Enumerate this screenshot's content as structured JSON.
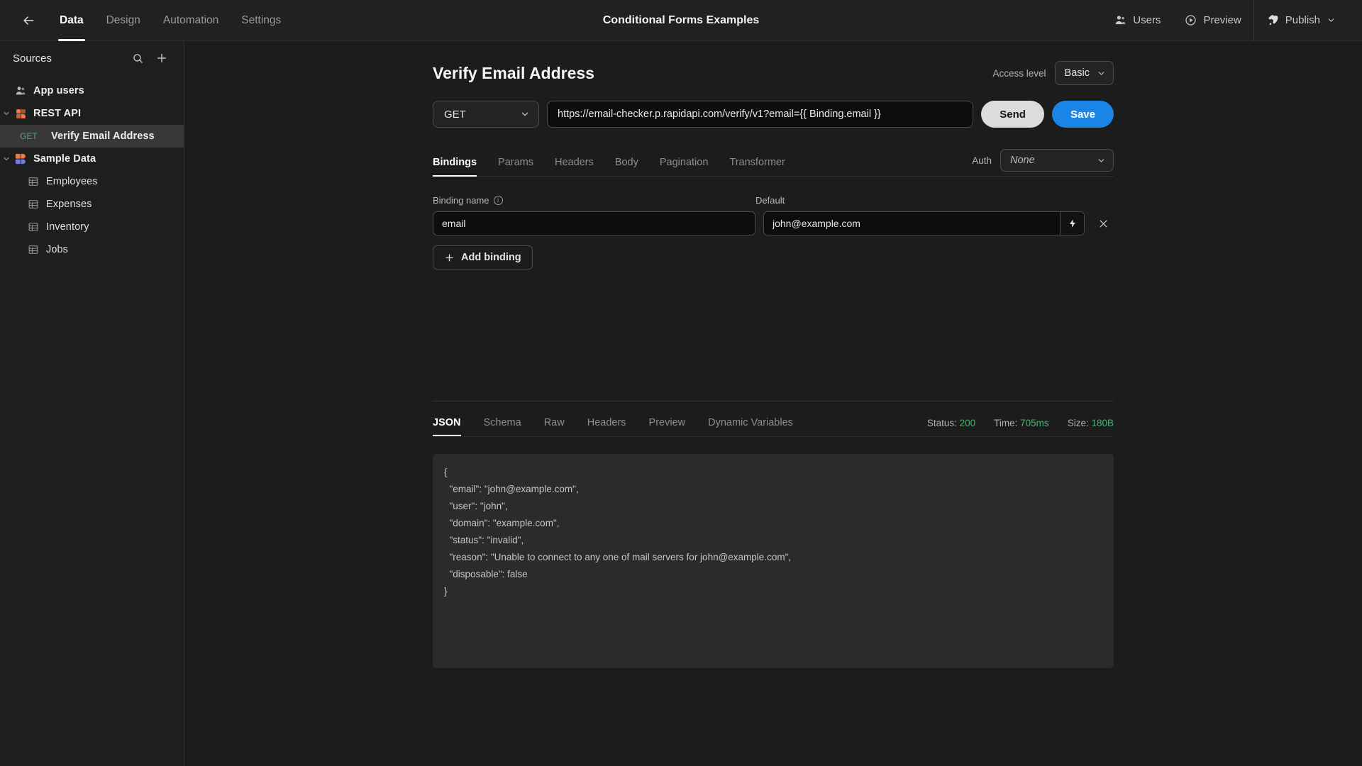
{
  "topbar": {
    "back_icon": "arrow-left-icon",
    "nav_tabs": [
      {
        "label": "Data",
        "active": true
      },
      {
        "label": "Design",
        "active": false
      },
      {
        "label": "Automation",
        "active": false
      },
      {
        "label": "Settings",
        "active": false
      }
    ],
    "window_title": "Conditional Forms Examples",
    "users_label": "Users",
    "users_icon": "user-icon",
    "preview_label": "Preview",
    "preview_icon": "play-circle-icon",
    "publish_label": "Publish",
    "publish_icon": "rocket-icon",
    "publish_caret_icon": "chevron-down-icon"
  },
  "sidebar": {
    "title": "Sources",
    "search_icon": "search-icon",
    "add_icon": "plus-icon",
    "items": [
      {
        "label": "App users",
        "icon": "user-icon",
        "depth": 0,
        "bold": true,
        "selected": false,
        "chevron": "",
        "method": ""
      },
      {
        "label": "REST API",
        "icon": "rest-api-icon",
        "depth": 0,
        "bold": true,
        "selected": false,
        "chevron": "chevron-down-icon",
        "method": ""
      },
      {
        "label": "Verify Email Address",
        "icon": "",
        "depth": 2,
        "bold": true,
        "selected": true,
        "chevron": "",
        "method": "GET"
      },
      {
        "label": "Sample Data",
        "icon": "sample-data-icon",
        "depth": 0,
        "bold": true,
        "selected": false,
        "chevron": "chevron-down-icon",
        "method": ""
      },
      {
        "label": "Employees",
        "icon": "table-icon",
        "depth": 1,
        "bold": false,
        "selected": false,
        "chevron": "",
        "method": ""
      },
      {
        "label": "Expenses",
        "icon": "table-icon",
        "depth": 1,
        "bold": false,
        "selected": false,
        "chevron": "",
        "method": ""
      },
      {
        "label": "Inventory",
        "icon": "table-icon",
        "depth": 1,
        "bold": false,
        "selected": false,
        "chevron": "",
        "method": ""
      },
      {
        "label": "Jobs",
        "icon": "table-icon",
        "depth": 1,
        "bold": false,
        "selected": false,
        "chevron": "",
        "method": ""
      }
    ]
  },
  "request": {
    "title": "Verify Email Address",
    "access_level_label": "Access level",
    "access_level_value": "Basic",
    "method": "GET",
    "url": "https://email-checker.p.rapidapi.com/verify/v1?email={{ Binding.email }}",
    "url_placeholder": "Enter request URL",
    "send_label": "Send",
    "save_label": "Save",
    "tabs": [
      {
        "label": "Bindings",
        "active": true
      },
      {
        "label": "Params",
        "active": false
      },
      {
        "label": "Headers",
        "active": false
      },
      {
        "label": "Body",
        "active": false
      },
      {
        "label": "Pagination",
        "active": false
      },
      {
        "label": "Transformer",
        "active": false
      }
    ],
    "auth_label": "Auth",
    "auth_value": "None"
  },
  "bindings": {
    "name_column_label": "Binding name",
    "info_icon": "info-icon",
    "default_column_label": "Default",
    "rows": [
      {
        "name": "email",
        "name_placeholder": "Binding name",
        "default": "john@example.com",
        "default_placeholder": "Default value",
        "bolt_icon": "lightning-bolt-icon",
        "remove_icon": "close-icon"
      }
    ],
    "add_label": "Add binding",
    "add_icon": "plus-icon"
  },
  "response": {
    "tabs": [
      {
        "label": "JSON",
        "active": true
      },
      {
        "label": "Schema",
        "active": false
      },
      {
        "label": "Raw",
        "active": false
      },
      {
        "label": "Headers",
        "active": false
      },
      {
        "label": "Preview",
        "active": false
      },
      {
        "label": "Dynamic Variables",
        "active": false
      }
    ],
    "status_label": "Status:",
    "status_value": "200",
    "time_label": "Time:",
    "time_value": "705ms",
    "size_label": "Size:",
    "size_value": "180B",
    "json_body": "{\n  \"email\": \"john@example.com\",\n  \"user\": \"john\",\n  \"domain\": \"example.com\",\n  \"status\": \"invalid\",\n  \"reason\": \"Unable to connect to any one of mail servers for john@example.com\",\n  \"disposable\": false\n}"
  },
  "colors": {
    "accent_blue": "#1b84e7",
    "success_green": "#4caf72",
    "method_green": "#4aa866",
    "sidebar_bg": "#1e1e1e",
    "main_bg": "#1c1c1c",
    "selected_row": "#383838"
  }
}
